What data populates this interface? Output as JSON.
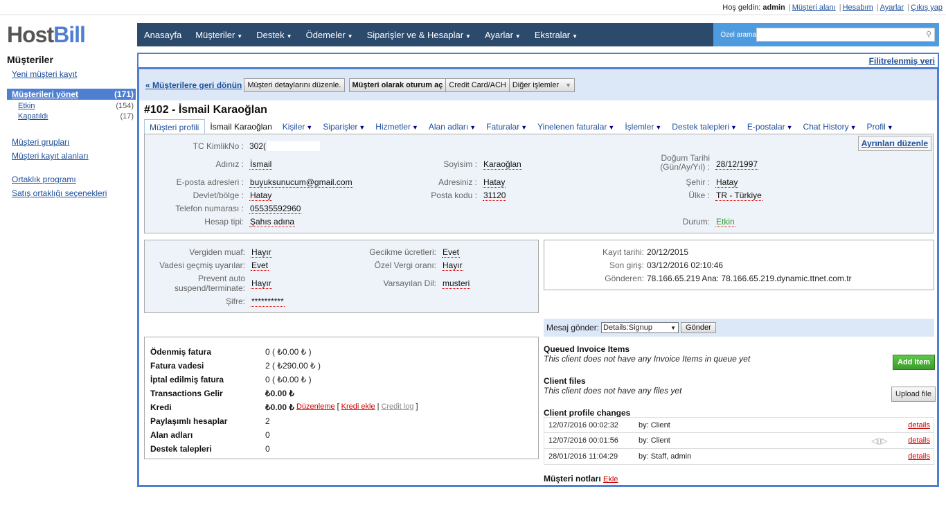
{
  "topbar": {
    "welcome": "Hoş geldin:",
    "user": "admin",
    "links": [
      "Müşteri alanı",
      "Hesabım",
      "Ayarlar",
      "Çıkış yap"
    ]
  },
  "logo": {
    "part1": "Host",
    "part2": "Bill"
  },
  "sidebar": {
    "title": "Müşteriler",
    "new_customer": "Yeni müşteri kayıt",
    "manage": {
      "label": "Müşterileri yönet",
      "count": "(171)"
    },
    "subs": [
      {
        "label": "Etkin",
        "count": "(154)"
      },
      {
        "label": "Kapatıldı",
        "count": "(17)"
      }
    ],
    "links1": [
      "Müşteri grupları",
      "Müşteri kayıt alanları"
    ],
    "links2": [
      "Ortaklık programı",
      "Satış ortaklığı seçenekleri"
    ]
  },
  "nav": {
    "items": [
      "Anasayfa",
      "Müşteriler",
      "Destek",
      "Ödemeler",
      "Siparişler ve & Hesaplar",
      "Ayarlar",
      "Ekstralar"
    ],
    "search_label": "Özel arama"
  },
  "filter": "Filitrelenmiş veri",
  "actions": {
    "back": "« Müşterilere geri dönün",
    "edit": "Müşteri detaylarını düzenle.",
    "login": "Müşteri olarak oturum aç",
    "cc": "Credit Card/ACH",
    "other": "Diğer işlemler"
  },
  "title": "#102 - İsmail Karaoğlan",
  "tabs": [
    "Müşteri profili",
    "İsmail Karaoğlan",
    "Kişiler",
    "Siparişler",
    "Hizmetler",
    "Alan adları",
    "Faturalar",
    "Yinelenen faturalar",
    "İşlemler",
    "Destek talepleri",
    "E-postalar",
    "Chat History",
    "Profil"
  ],
  "profile": {
    "edit_btn": "Ayrınları düzenle",
    "tc_label": "TC KimlikNo :",
    "tc_value": "302(",
    "name_label": "Adınız :",
    "name": "İsmail",
    "surname_label": "Soyisim :",
    "surname": "Karaoğlan",
    "dob_label1": "Doğum Tarihi",
    "dob_label2": "(Gün/Ay/Yıl) :",
    "dob": "28/12/1997",
    "email_label": "E-posta adresleri :",
    "email": "buyuksunucum@gmail.com",
    "addr_label": "Adresiniz :",
    "addr": "Hatay",
    "city_label": "Şehir :",
    "city": "Hatay",
    "state_label": "Devlet/bölge :",
    "state": "Hatay",
    "zip_label": "Posta kodu :",
    "zip": "31120",
    "country_label": "Ülke :",
    "country": "TR - Türkiye",
    "phone_label": "Telefon numarası :",
    "phone": "05535592960",
    "type_label": "Hesap tipi:",
    "type": "Şahıs adına",
    "status_label": "Durum:",
    "status": "Etkin"
  },
  "settings": {
    "tax_label": "Vergiden muaf:",
    "tax": "Hayır",
    "late_label": "Gecikme ücretleri:",
    "late": "Evet",
    "overdue_label": "Vadesi geçmiş uyarılar:",
    "overdue": "Evet",
    "vat_label": "Özel Vergi oranı:",
    "vat": "Hayır",
    "prevent_label1": "Prevent auto",
    "prevent_label2": "suspend/terminate:",
    "prevent": "Hayır",
    "lang_label": "Varsayılan Dil:",
    "lang": "musteri",
    "pass_label": "Şifre:",
    "pass": "**********"
  },
  "info": {
    "reg_label": "Kayıt tarihi:",
    "reg": "20/12/2015",
    "last_label": "Son giriş:",
    "last": "03/12/2016 02:10:46",
    "from_label": "Gönderen:",
    "from": "78.166.65.219 Ana: 78.166.65.219.dynamic.ttnet.com.tr"
  },
  "summary": [
    {
      "k": "Ödenmiş fatura",
      "v": "0 ( ₺0.00 ₺ )"
    },
    {
      "k": "Fatura vadesi",
      "v": "2 ( ₺290.00 ₺ )"
    },
    {
      "k": "İptal edilmiş fatura",
      "v": "0 ( ₺0.00 ₺ )"
    },
    {
      "k": "Transactions Gelir",
      "v": "₺0.00 ₺"
    },
    {
      "k": "Kredi",
      "v": "₺0.00 ₺"
    },
    {
      "k": "Paylaşımlı hesaplar",
      "v": "2"
    },
    {
      "k": "Alan adları",
      "v": "0"
    },
    {
      "k": "Destek talepleri",
      "v": "0"
    }
  ],
  "credit_links": {
    "edit": "Düzenleme",
    "add": "Kredi ekle",
    "log": "Credit log"
  },
  "message": {
    "label": "Mesaj gönder:",
    "select": "Details:Signup",
    "send": "Gönder"
  },
  "queued": {
    "title": "Queued Invoice Items",
    "text": "This client does not have any Invoice Items in queue yet",
    "btn": "Add Item"
  },
  "files": {
    "title": "Client files",
    "text": "This client does not have any files yet",
    "btn": "Upload file"
  },
  "changes": {
    "title": "Client profile changes",
    "rows": [
      {
        "date": "12/07/2016 00:02:32",
        "by": "by: Client",
        "link": "details"
      },
      {
        "date": "12/07/2016 00:01:56",
        "by": "by: Client",
        "link": "details"
      },
      {
        "date": "28/01/2016 11:04:29",
        "by": "by: Staff, admin",
        "link": "details"
      }
    ]
  },
  "notes": {
    "title": "Müşteri notları",
    "link": "Ekle"
  }
}
